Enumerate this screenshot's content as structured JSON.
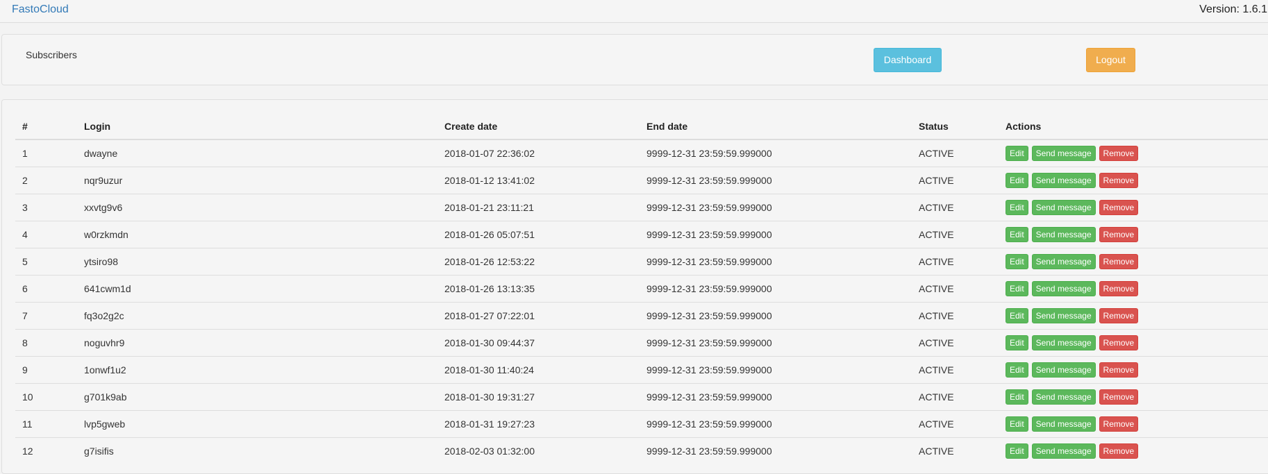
{
  "header": {
    "brand": "FastoCloud",
    "version": "Version: 1.6.1"
  },
  "nav": {
    "subscribers_label": "Subscribers",
    "dashboard_label": "Dashboard",
    "logout_label": "Logout"
  },
  "table": {
    "columns": [
      "#",
      "Login",
      "Create date",
      "End date",
      "Status",
      "Actions"
    ],
    "action_labels": {
      "edit": "Edit",
      "send": "Send message",
      "remove": "Remove"
    },
    "rows": [
      {
        "num": "1",
        "login": "dwayne",
        "create": "2018-01-07 22:36:02",
        "end": "9999-12-31 23:59:59.999000",
        "status": "ACTIVE"
      },
      {
        "num": "2",
        "login": "nqr9uzur",
        "create": "2018-01-12 13:41:02",
        "end": "9999-12-31 23:59:59.999000",
        "status": "ACTIVE"
      },
      {
        "num": "3",
        "login": "xxvtg9v6",
        "create": "2018-01-21 23:11:21",
        "end": "9999-12-31 23:59:59.999000",
        "status": "ACTIVE"
      },
      {
        "num": "4",
        "login": "w0rzkmdn",
        "create": "2018-01-26 05:07:51",
        "end": "9999-12-31 23:59:59.999000",
        "status": "ACTIVE"
      },
      {
        "num": "5",
        "login": "ytsiro98",
        "create": "2018-01-26 12:53:22",
        "end": "9999-12-31 23:59:59.999000",
        "status": "ACTIVE"
      },
      {
        "num": "6",
        "login": "641cwm1d",
        "create": "2018-01-26 13:13:35",
        "end": "9999-12-31 23:59:59.999000",
        "status": "ACTIVE"
      },
      {
        "num": "7",
        "login": "fq3o2g2c",
        "create": "2018-01-27 07:22:01",
        "end": "9999-12-31 23:59:59.999000",
        "status": "ACTIVE"
      },
      {
        "num": "8",
        "login": "noguvhr9",
        "create": "2018-01-30 09:44:37",
        "end": "9999-12-31 23:59:59.999000",
        "status": "ACTIVE"
      },
      {
        "num": "9",
        "login": "1onwf1u2",
        "create": "2018-01-30 11:40:24",
        "end": "9999-12-31 23:59:59.999000",
        "status": "ACTIVE"
      },
      {
        "num": "10",
        "login": "g701k9ab",
        "create": "2018-01-30 19:31:27",
        "end": "9999-12-31 23:59:59.999000",
        "status": "ACTIVE"
      },
      {
        "num": "11",
        "login": "lvp5gweb",
        "create": "2018-01-31 19:27:23",
        "end": "9999-12-31 23:59:59.999000",
        "status": "ACTIVE"
      },
      {
        "num": "12",
        "login": "g7isifis",
        "create": "2018-02-03 01:32:00",
        "end": "9999-12-31 23:59:59.999000",
        "status": "ACTIVE"
      }
    ]
  }
}
